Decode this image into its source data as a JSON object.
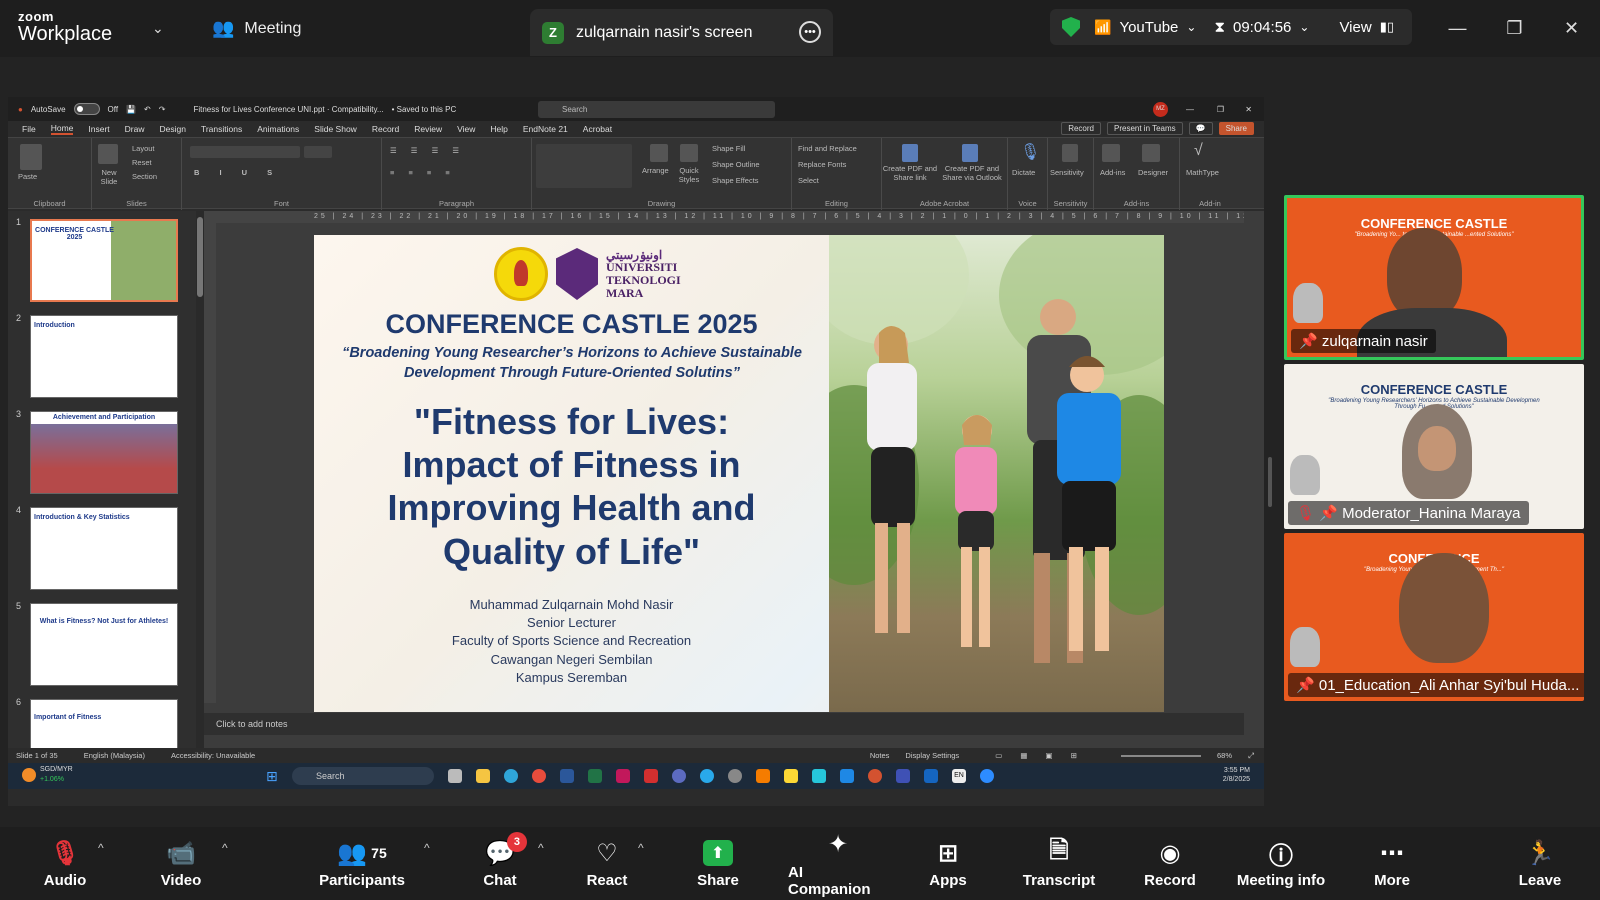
{
  "zoom": {
    "brand_top": "zoom",
    "brand_bottom": "Workplace",
    "meeting_tab": "Meeting",
    "screen_label": "zulqarnain nasir's screen",
    "screen_badge": "Z",
    "stream": "YouTube",
    "timer": "09:04:56",
    "view": "View"
  },
  "ppt": {
    "autosave": "AutoSave",
    "autosave_state": "Off",
    "file_title": "Fitness for Lives Conference UNI.ppt · Compatibility...",
    "saved": "• Saved to this PC",
    "search_placeholder": "Search",
    "user_initials": "MZ",
    "menu": [
      "File",
      "Home",
      "Insert",
      "Draw",
      "Design",
      "Transitions",
      "Animations",
      "Slide Show",
      "Record",
      "Review",
      "View",
      "Help",
      "EndNote 21",
      "Acrobat"
    ],
    "menu_right": {
      "record": "Record",
      "teams": "Present in Teams",
      "share": "Share"
    },
    "ribbon_groups": [
      "Clipboard",
      "Slides",
      "Font",
      "Paragraph",
      "Drawing",
      "Editing",
      "Adobe Acrobat",
      "Voice",
      "Sensitivity",
      "Add-ins",
      "Add-in"
    ],
    "ribbon_labels": {
      "paste": "Paste",
      "new_slide": "New Slide",
      "layout": "Layout",
      "reset": "Reset",
      "section": "Section",
      "arrange": "Arrange",
      "quick_styles": "Quick Styles",
      "shape_fill": "Shape Fill",
      "shape_outline": "Shape Outline",
      "shape_effects": "Shape Effects",
      "find_replace": "Find and Replace",
      "replace_fonts": "Replace Fonts",
      "select": "Select",
      "create_pdf_share": "Create PDF and Share link",
      "create_pdf_outlook": "Create PDF and Share via Outlook",
      "dictate": "Dictate",
      "sensitivity": "Sensitivity",
      "addins": "Add-ins",
      "designer": "Designer",
      "mathtype": "MathType"
    },
    "thumb_numbers": [
      "1",
      "2",
      "3",
      "4",
      "5",
      "6"
    ],
    "thumb_titles": [
      "CONFERENCE CASTLE 2025",
      "Introduction",
      "Achievement and Participation",
      "Introduction & Key Statistics",
      "What is Fitness? Not Just for Athletes!",
      "Important of Fitness"
    ],
    "ruler": "25 | 24 | 23 | 22 | 21 | 20 | 19 | 18 | 17 | 16 | 15 | 14 | 13 | 12 | 11 | 10 | 9 | 8 | 7 | 6 | 5 | 4 | 3 | 2 | 1 | 0 | 1 | 2 | 3 | 4 | 5 | 6 | 7 | 8 | 9 | 10 | 11 | 12 | 13 | 14 | 15 | 16 | 17 | 18 | 19 | 20 | 21 | 22 | 23 | 24 | 25",
    "notes_placeholder": "Click to add notes",
    "status": {
      "slide": "Slide 1 of 35",
      "lang": "English (Malaysia)",
      "access": "Accessibility: Unavailable",
      "notes": "Notes",
      "display": "Display Settings",
      "zoom": "68%"
    }
  },
  "slide": {
    "uitm_arabic": "اونيۏرسيتي",
    "uitm_1": "UNIVERSITI",
    "uitm_2": "TEKNOLOGI",
    "uitm_3": "MARA",
    "heading": "CONFERENCE CASTLE 2025",
    "subheading": "“Broadening Young Researcher’s Horizons to Achieve Sustainable Development Through Future-Oriented Solutins”",
    "title": "\"Fitness for Lives: Impact of Fitness in Improving Health and Quality of Life\"",
    "author_lines": [
      "Muhammad Zulqarnain Mohd Nasir",
      "Senior Lecturer",
      "Faculty of Sports Science and Recreation",
      "Cawangan Negeri Sembilan",
      "Kampus Seremban"
    ]
  },
  "taskbar": {
    "ticker": "SGD/MYR",
    "ticker_change": "+1.06%",
    "search": "Search",
    "lang": "EN",
    "time": "3:55 PM",
    "date": "2/8/2025"
  },
  "participants_video": [
    {
      "name": "zulqarnain nasir",
      "banner": "CONFERENCE CASTLE",
      "banner_sub": "\"Broadening Yo... to Achieve Sustainable ...ented Solutions\""
    },
    {
      "name": "Moderator_Hanina Maraya",
      "banner": "CONFERENCE CASTLE",
      "banner_sub": "\"Broadening Young Researchers' Horizons to Achieve Sustainable Developmen Through Fu...ented Solutions\""
    },
    {
      "name": "01_Education_Ali Anhar Syi'bul Huda...",
      "banner": "CONFERENCE",
      "banner_sub": "\"Broadening Young Researche... Development Th...\""
    }
  ],
  "bottom": {
    "audio": "Audio",
    "video": "Video",
    "participants": "Participants",
    "participants_count": "75",
    "chat": "Chat",
    "chat_badge": "3",
    "react": "React",
    "share": "Share",
    "ai": "AI Companion",
    "apps": "Apps",
    "transcript": "Transcript",
    "record": "Record",
    "info": "Meeting info",
    "more": "More",
    "leave": "Leave"
  },
  "colors": {
    "accent_green": "#22b14c",
    "slide_navy": "#1f3a6e",
    "banner_orange": "#e85a1f",
    "ppt_orange": "#d35230"
  }
}
